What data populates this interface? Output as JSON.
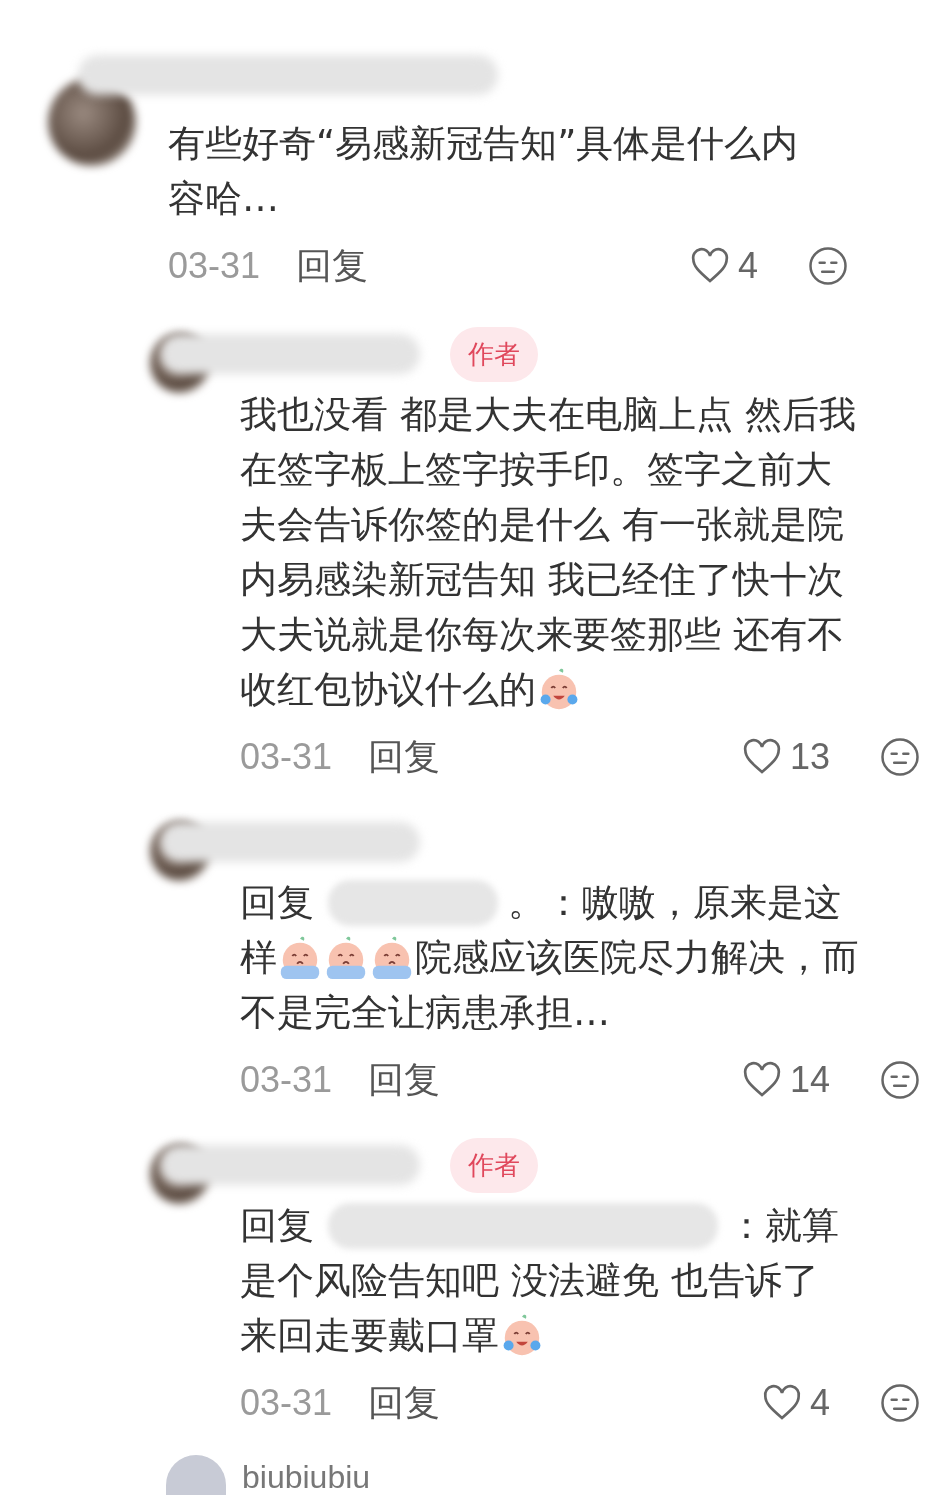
{
  "comments": [
    {
      "kind": "top",
      "lines": [
        [
          {
            "kind": "text",
            "text": "有些好奇“易感新冠告知”具体是什么内"
          }
        ],
        [
          {
            "kind": "text",
            "text": "容哈…"
          }
        ]
      ],
      "date": "03-31",
      "reply_label": "回复",
      "likes": "4"
    },
    {
      "kind": "reply",
      "badge": "作者",
      "lines": [
        [
          {
            "kind": "text",
            "text": "我也没看 都是大夫在电脑上点 然后我"
          }
        ],
        [
          {
            "kind": "text",
            "text": "在签字板上签字按手印。签字之前大"
          }
        ],
        [
          {
            "kind": "text",
            "text": "夫会告诉你签的是什么 有一张就是院"
          }
        ],
        [
          {
            "kind": "text",
            "text": "内易感染新冠告知 我已经住了快十次"
          }
        ],
        [
          {
            "kind": "text",
            "text": "大夫说就是你每次来要签那些 还有不"
          }
        ],
        [
          {
            "kind": "text",
            "text": "收红包协议什么的"
          },
          {
            "kind": "emoji_laugh_cry"
          }
        ]
      ],
      "date": "03-31",
      "reply_label": "回复",
      "likes": "13"
    },
    {
      "kind": "reply",
      "lines": [
        [
          {
            "kind": "text",
            "text": "回复"
          },
          {
            "kind": "redacted"
          },
          {
            "kind": "text",
            "text": "。：嗷嗷，原来是这"
          }
        ],
        [
          {
            "kind": "text",
            "text": "样"
          },
          {
            "kind": "emoji_sob"
          },
          {
            "kind": "emoji_sob"
          },
          {
            "kind": "emoji_sob"
          },
          {
            "kind": "text",
            "text": "院感应该医院尽力解决，而"
          }
        ],
        [
          {
            "kind": "text",
            "text": "不是完全让病患承担…"
          }
        ]
      ],
      "date": "03-31",
      "reply_label": "回复",
      "likes": "14"
    },
    {
      "kind": "reply",
      "badge": "作者",
      "lines": [
        [
          {
            "kind": "text",
            "text": "回复"
          },
          {
            "kind": "redacted_long"
          },
          {
            "kind": "text",
            "text": "：就算"
          }
        ],
        [
          {
            "kind": "text",
            "text": "是个风险告知吧 没法避免 也告诉了"
          }
        ],
        [
          {
            "kind": "text",
            "text": "来回走要戴口罩"
          },
          {
            "kind": "emoji_laugh_cry"
          }
        ]
      ],
      "date": "03-31",
      "reply_label": "回复",
      "likes": "4"
    }
  ],
  "next_comment": {
    "name": "biubiubiu"
  }
}
